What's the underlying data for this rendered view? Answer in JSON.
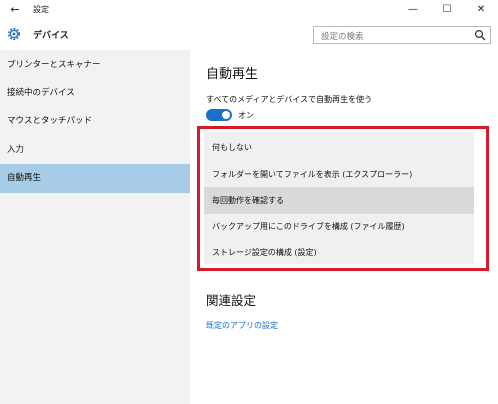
{
  "window": {
    "back_icon": "←",
    "title": "設定",
    "minimize": "—",
    "maximize": "☐",
    "close": "✕"
  },
  "header": {
    "section_title": "デバイス",
    "search_placeholder": "設定の検索"
  },
  "sidebar": {
    "items": [
      {
        "label": "プリンターとスキャナー"
      },
      {
        "label": "接続中のデバイス"
      },
      {
        "label": "マウスとタッチパッド"
      },
      {
        "label": "入力"
      },
      {
        "label": "自動再生",
        "active": true
      }
    ]
  },
  "main": {
    "title": "自動再生",
    "toggle_description": "すべてのメディアとデバイスで自動再生を使う",
    "toggle_state": "オン",
    "toggle_on": true,
    "options": [
      {
        "label": "何もしない"
      },
      {
        "label": "フォルダーを開いてファイルを表示 (エクスプローラー)"
      },
      {
        "label": "毎回動作を確認する",
        "selected": true
      },
      {
        "label": "バックアップ用にこのドライブを構成 (ファイル履歴)"
      },
      {
        "label": "ストレージ設定の構成 (設定)"
      }
    ],
    "related_title": "関連設定",
    "related_link": "既定のアプリの設定"
  },
  "colors": {
    "accent": "#1a6fc9",
    "sidebar_bg": "#f2f2f2",
    "sidebar_active": "#a7cce8",
    "highlight_border": "#d8192b",
    "dropdown_bg": "#f0f0f0",
    "dropdown_selected": "#d9d9d9"
  }
}
